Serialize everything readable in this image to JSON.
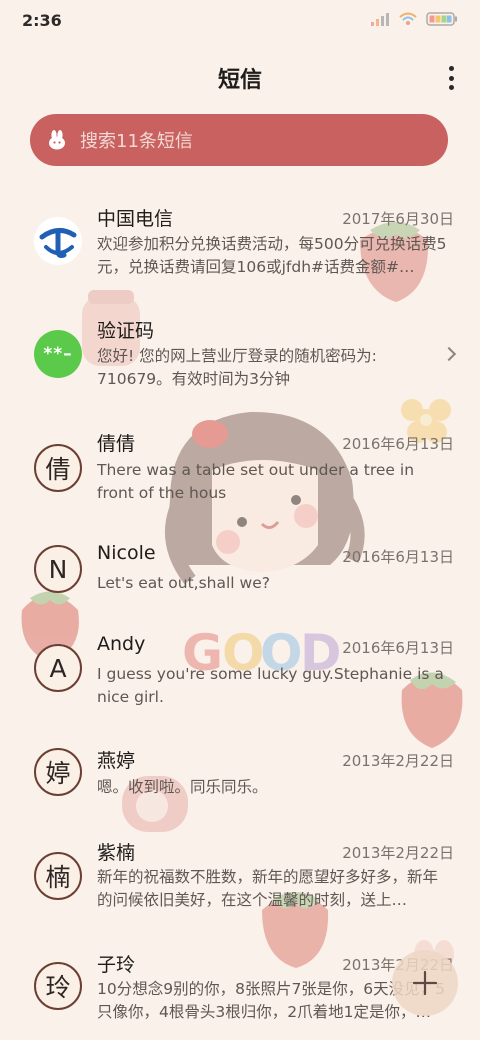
{
  "status_bar": {
    "time": "2:36"
  },
  "header": {
    "title": "短信"
  },
  "search": {
    "placeholder": "搜索11条短信"
  },
  "conversations": [
    {
      "name": "中国电信",
      "date": "2017年6月30日",
      "preview": "欢迎参加积分兑换话费活动，每500分可兑换话费5元，兑换话费请回复106或jfdh#话费金额#…",
      "avatar_icon": "china-telecom-logo"
    },
    {
      "name": "验证码",
      "date": "",
      "preview": "您好! 您的网上营业厅登录的随机密码为: 710679。有效时间为3分钟",
      "avatar_text": "**–"
    },
    {
      "name": "倩倩",
      "date": "2016年6月13日",
      "preview": "There was a table set out under a tree in front of the hous",
      "avatar_text": "倩"
    },
    {
      "name": "Nicole",
      "date": "2016年6月13日",
      "preview": "Let's eat out,shall we?",
      "avatar_text": "N"
    },
    {
      "name": "Andy",
      "date": "2016年6月13日",
      "preview": "I guess you're some lucky guy.Stephanie is a nice girl.",
      "avatar_text": "A"
    },
    {
      "name": "燕婷",
      "date": "2013年2月22日",
      "preview": "嗯。收到啦。同乐同乐。",
      "avatar_text": "婷"
    },
    {
      "name": "紫楠",
      "date": "2013年2月22日",
      "preview": "新年的祝福数不胜数，新年的愿望好多好多，新年的问候依旧美好，在这个温馨的时刻，送上…",
      "avatar_text": "楠"
    },
    {
      "name": "子玲",
      "date": "2013年2月22日",
      "preview": "10分想念9别的你，8张照片7张是你，6天没见，5只像你，4根骨头3根归你，2爪着地1定是你，…",
      "avatar_text": "玲"
    }
  ],
  "background_stickers": {
    "word": "GOOD"
  },
  "colors": {
    "accent": "#c8615f",
    "background": "#f9f1ea",
    "avatar_border": "#6b3f34",
    "verify_green": "#5bca4b"
  }
}
